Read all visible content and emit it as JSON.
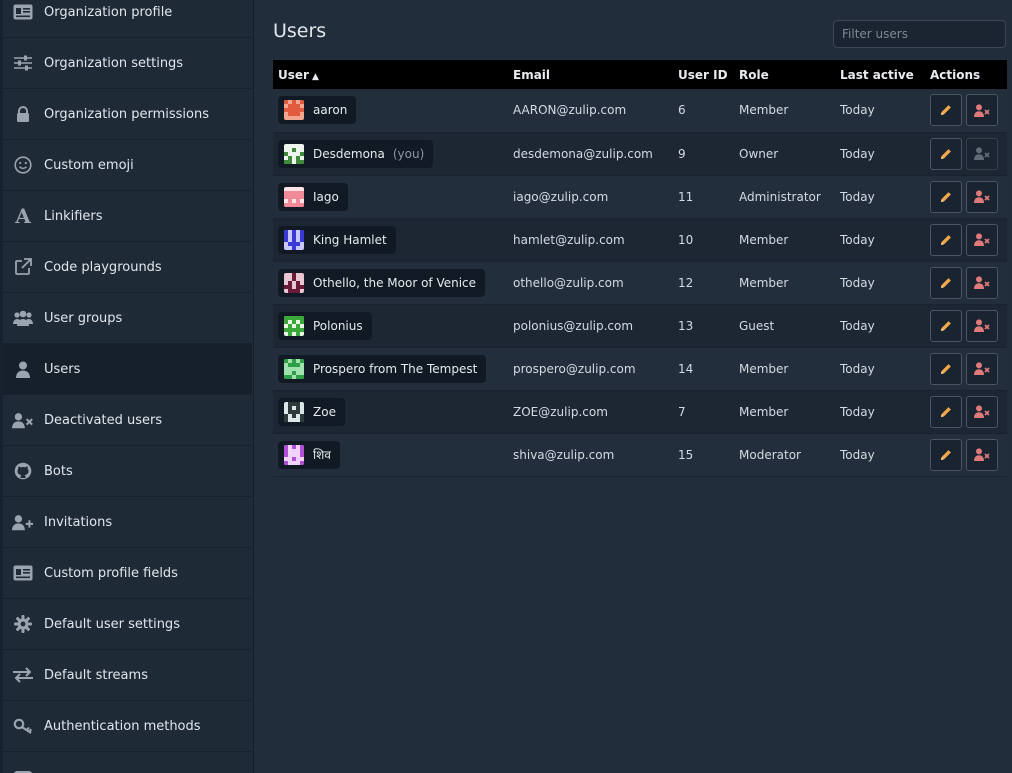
{
  "sidebar": {
    "items": [
      {
        "label": "Organization profile",
        "icon": "id-card-icon"
      },
      {
        "label": "Organization settings",
        "icon": "sliders-icon"
      },
      {
        "label": "Organization permissions",
        "icon": "lock-icon"
      },
      {
        "label": "Custom emoji",
        "icon": "smile-icon"
      },
      {
        "label": "Linkifiers",
        "icon": "font-icon"
      },
      {
        "label": "Code playgrounds",
        "icon": "external-link-icon"
      },
      {
        "label": "User groups",
        "icon": "users-icon"
      },
      {
        "label": "Users",
        "icon": "user-icon",
        "active": true
      },
      {
        "label": "Deactivated users",
        "icon": "user-times-icon"
      },
      {
        "label": "Bots",
        "icon": "github-icon"
      },
      {
        "label": "Invitations",
        "icon": "user-plus-icon"
      },
      {
        "label": "Custom profile fields",
        "icon": "id-card-icon"
      },
      {
        "label": "Default user settings",
        "icon": "gear-icon"
      },
      {
        "label": "Default streams",
        "icon": "exchange-icon"
      },
      {
        "label": "Authentication methods",
        "icon": "key-icon"
      }
    ]
  },
  "main": {
    "title": "Users",
    "filter_placeholder": "Filter users",
    "columns": {
      "user": "User",
      "email": "Email",
      "user_id": "User ID",
      "role": "Role",
      "last_active": "Last active",
      "actions": "Actions"
    },
    "rows": [
      {
        "name": "aaron",
        "email": "AARON@zulip.com",
        "id": "6",
        "role": "Member",
        "last": "Today",
        "colors": [
          "#e35b3f",
          "#f2a58f"
        ]
      },
      {
        "name": "Desdemona",
        "you": "(you)",
        "email": "desdemona@zulip.com",
        "id": "9",
        "role": "Owner",
        "last": "Today",
        "colors": [
          "#3f8a3b",
          "#eef5ec"
        ],
        "deactivate_disabled": true
      },
      {
        "name": "Iago",
        "email": "iago@zulip.com",
        "id": "11",
        "role": "Administrator",
        "last": "Today",
        "colors": [
          "#f08a98",
          "#fde3e7"
        ]
      },
      {
        "name": "King Hamlet",
        "email": "hamlet@zulip.com",
        "id": "10",
        "role": "Member",
        "last": "Today",
        "colors": [
          "#3b39d6",
          "#c8c7ff"
        ]
      },
      {
        "name": "Othello, the Moor of Venice",
        "email": "othello@zulip.com",
        "id": "12",
        "role": "Member",
        "last": "Today",
        "colors": [
          "#6b1b3a",
          "#e8c7d3"
        ]
      },
      {
        "name": "Polonius",
        "email": "polonius@zulip.com",
        "id": "13",
        "role": "Guest",
        "last": "Today",
        "colors": [
          "#3ba83a",
          "#e9f8e5"
        ]
      },
      {
        "name": "Prospero from The Tempest",
        "email": "prospero@zulip.com",
        "id": "14",
        "role": "Member",
        "last": "Today",
        "colors": [
          "#2e9e47",
          "#9fe2ad"
        ]
      },
      {
        "name": "Zoe",
        "email": "ZOE@zulip.com",
        "id": "7",
        "role": "Member",
        "last": "Today",
        "colors": [
          "#2c3a3a",
          "#dde6e6"
        ]
      },
      {
        "name": "शिव",
        "email": "shiva@zulip.com",
        "id": "15",
        "role": "Moderator",
        "last": "Today",
        "colors": [
          "#b050d6",
          "#f1d2fb"
        ]
      }
    ]
  },
  "colors": {
    "edit_icon": "#f0a84a",
    "deactivate_icon": "#e07a7a",
    "disabled_icon": "#9aa4ae"
  }
}
